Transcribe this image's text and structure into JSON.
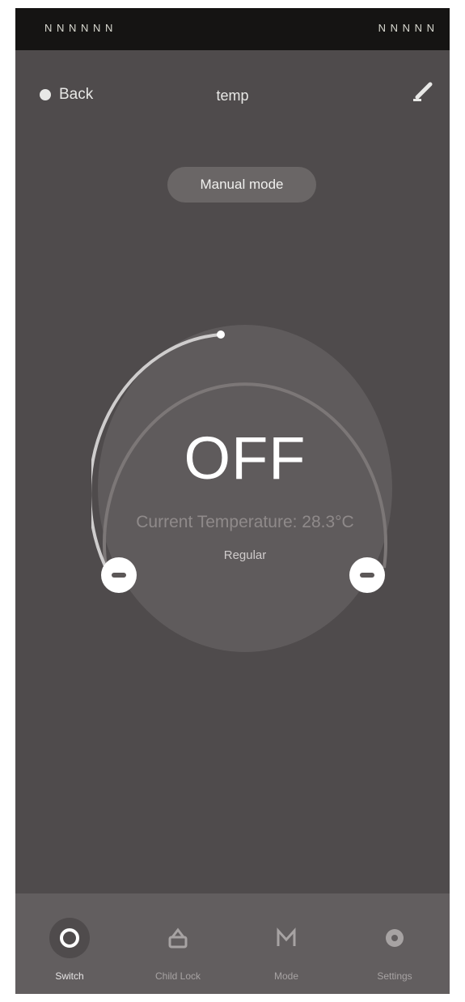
{
  "status_bar": {
    "left": "N N N N N N",
    "right": "N N N N N"
  },
  "header": {
    "back_label": "Back",
    "title": "temp",
    "edit_icon": "pencil-icon"
  },
  "mode": {
    "label": "Manual mode"
  },
  "dial": {
    "state": "OFF",
    "current_temp": "Current Temperature: 28.3°C",
    "subtitle": "Regular",
    "level": 0.45
  },
  "tabs": [
    {
      "label": "Switch",
      "icon": "power-icon",
      "active": true
    },
    {
      "label": "Child Lock",
      "icon": "lock-icon",
      "active": false
    },
    {
      "label": "Mode",
      "icon": "mode-icon",
      "active": false
    },
    {
      "label": "Settings",
      "icon": "gear-icon",
      "active": false
    }
  ],
  "colors": {
    "background": "#4f4b4c",
    "tab_bar": "#625e5f",
    "status_bar": "#151413",
    "dial_fill": "#5f5b5c",
    "arc": "#c8c6c6"
  }
}
